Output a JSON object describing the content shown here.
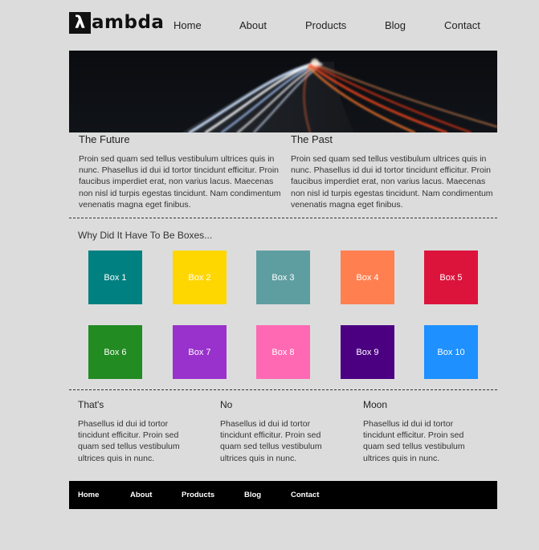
{
  "header": {
    "logo_mark": "λ",
    "logo_text": "ambda",
    "nav": [
      "Home",
      "About",
      "Products",
      "Blog",
      "Contact"
    ]
  },
  "columns": [
    {
      "title": "The Future",
      "text": "Proin sed quam sed tellus vestibulum ultrices quis in nunc. Phasellus id dui id tortor tincidunt efficitur. Proin faucibus imperdiet erat, non varius lacus. Maecenas non nisl id turpis egestas tincidunt. Nam condimentum venenatis magna eget finibus."
    },
    {
      "title": "The Past",
      "text": "Proin sed quam sed tellus vestibulum ultrices quis in nunc. Phasellus id dui id tortor tincidunt efficitur. Proin faucibus imperdiet erat, non varius lacus. Maecenas non nisl id turpis egestas tincidunt. Nam condimentum venenatis magna eget finibus."
    }
  ],
  "boxes_section": {
    "title": "Why Did It Have To Be Boxes...",
    "boxes": [
      {
        "label": "Box 1",
        "color": "#008080"
      },
      {
        "label": "Box 2",
        "color": "#FFD700"
      },
      {
        "label": "Box 3",
        "color": "#5F9EA0"
      },
      {
        "label": "Box 4",
        "color": "#FF7F50"
      },
      {
        "label": "Box 5",
        "color": "#DC143C"
      },
      {
        "label": "Box 6",
        "color": "#228B22"
      },
      {
        "label": "Box 7",
        "color": "#9932CC"
      },
      {
        "label": "Box 8",
        "color": "#FF69B4"
      },
      {
        "label": "Box 9",
        "color": "#4B0082"
      },
      {
        "label": "Box 10",
        "color": "#1E90FF"
      }
    ]
  },
  "bottom": [
    {
      "title": "That's",
      "text": "Phasellus id dui id tortor tincidunt efficitur. Proin sed quam sed tellus vestibulum ultrices quis in nunc."
    },
    {
      "title": "No",
      "text": "Phasellus id dui id tortor tincidunt efficitur. Proin sed quam sed tellus vestibulum ultrices quis in nunc."
    },
    {
      "title": "Moon",
      "text": "Phasellus id dui id tortor tincidunt efficitur. Proin sed quam sed tellus vestibulum ultrices quis in nunc."
    }
  ],
  "footer": {
    "nav": [
      "Home",
      "About",
      "Products",
      "Blog",
      "Contact"
    ]
  }
}
